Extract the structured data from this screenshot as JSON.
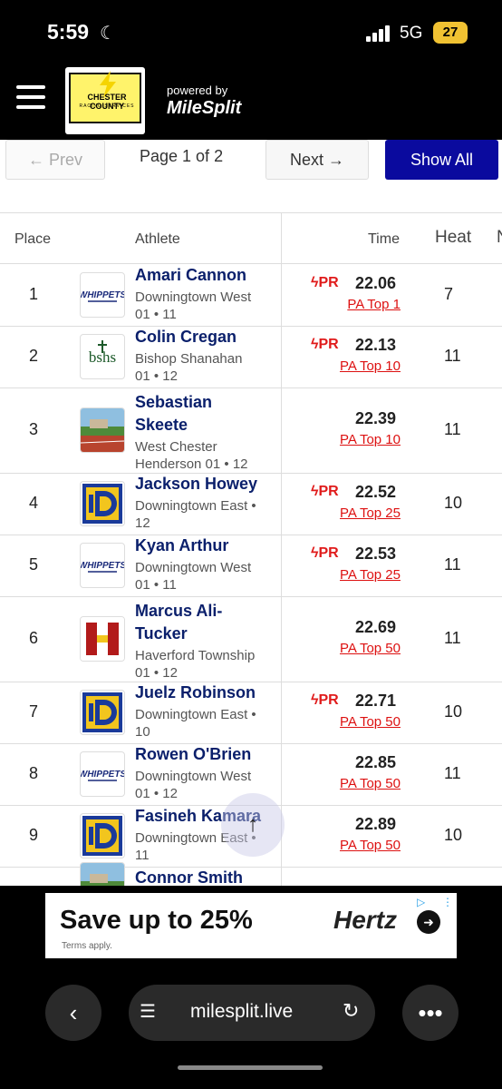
{
  "status_bar": {
    "time": "5:59",
    "network": "5G",
    "battery": "27"
  },
  "site": {
    "logo_title": "CHESTER COUNTY",
    "logo_sub": "RACING SERVICES",
    "powered_by": "powered by",
    "brand": "MileSplit"
  },
  "pager": {
    "prev": "← Prev",
    "page": "Page 1 of 2",
    "next": "Next →",
    "show_all": "Show All"
  },
  "table": {
    "headers": {
      "place": "Place",
      "athlete": "Athlete",
      "time": "Time",
      "heat": "Heat"
    },
    "rows": [
      {
        "place": "1",
        "name1": "Amari Cannon",
        "name2": "",
        "school1": "Downingtown West",
        "school2": "01 • 11",
        "pr": "PR",
        "time": "22.06",
        "top": "PA Top 1",
        "heat": "7",
        "badge": "WHIPPETS"
      },
      {
        "place": "2",
        "name1": "Colin Cregan",
        "name2": "",
        "school1": "Bishop Shanahan",
        "school2": "01 • 12",
        "pr": "PR",
        "time": "22.13",
        "top": "PA Top 10",
        "heat": "11",
        "badge": "bshs"
      },
      {
        "place": "3",
        "name1": "Sebastian",
        "name2": "Skeete",
        "school1": "West Chester",
        "school2": "Henderson 01 • 12",
        "pr": "",
        "time": "22.39",
        "top": "PA Top 10",
        "heat": "11",
        "badge": "photo"
      },
      {
        "place": "4",
        "name1": "Jackson Howey",
        "name2": "",
        "school1": "Downingtown East •",
        "school2": "12",
        "pr": "PR",
        "time": "22.52",
        "top": "PA Top 25",
        "heat": "10",
        "badge": "D"
      },
      {
        "place": "5",
        "name1": "Kyan Arthur",
        "name2": "",
        "school1": "Downingtown West",
        "school2": "01 • 11",
        "pr": "PR",
        "time": "22.53",
        "top": "PA Top 25",
        "heat": "11",
        "badge": "WHIPPETS"
      },
      {
        "place": "6",
        "name1": "Marcus Ali-",
        "name2": "Tucker",
        "school1": "Haverford Township",
        "school2": "01 • 12",
        "pr": "",
        "time": "22.69",
        "top": "PA Top 50",
        "heat": "11",
        "badge": "H"
      },
      {
        "place": "7",
        "name1": "Juelz Robinson",
        "name2": "",
        "school1": "Downingtown East •",
        "school2": "10",
        "pr": "PR",
        "time": "22.71",
        "top": "PA Top 50",
        "heat": "10",
        "badge": "D"
      },
      {
        "place": "8",
        "name1": "Rowen O'Brien",
        "name2": "",
        "school1": "Downingtown West",
        "school2": "01 • 12",
        "pr": "",
        "time": "22.85",
        "top": "PA Top 50",
        "heat": "11",
        "badge": "WHIPPETS"
      },
      {
        "place": "9",
        "name1": "Fasineh Kamara",
        "name2": "",
        "school1": "Downingtown East •",
        "school2": "11",
        "pr": "",
        "time": "22.89",
        "top": "PA Top 50",
        "heat": "10",
        "badge": "D"
      },
      {
        "place": "",
        "name1": "Connor Smith",
        "name2": "",
        "school1": "",
        "school2": "",
        "pr": "",
        "time": "",
        "top": "",
        "heat": "",
        "badge": "photo"
      }
    ]
  },
  "ad": {
    "headline": "Save up to 25%",
    "brand": "Hertz",
    "terms": "Terms apply."
  },
  "browser": {
    "url": "milesplit.live"
  },
  "colors": {
    "accent": "#0a0a9e",
    "pr": "#e01b1b",
    "name": "#0a1f6b"
  }
}
